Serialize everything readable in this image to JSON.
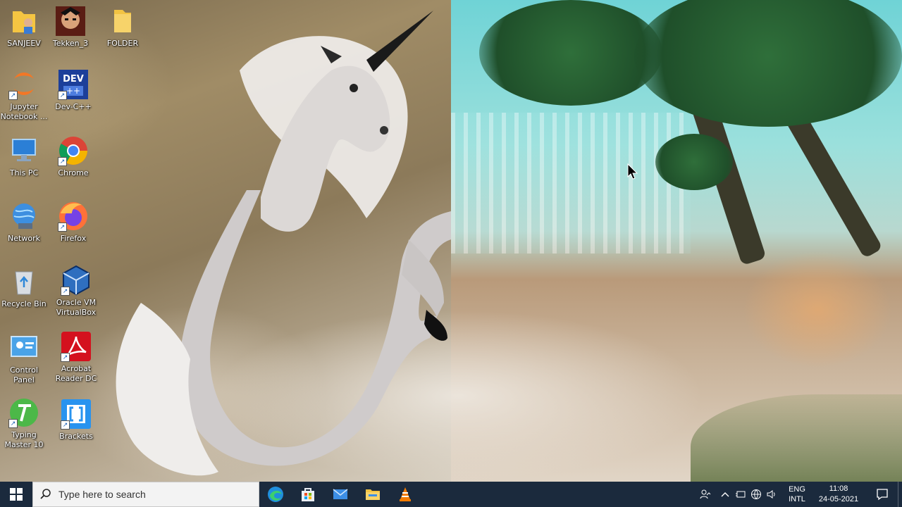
{
  "desktop": {
    "icons": [
      {
        "label": "SANJEEV",
        "icon": "user-folder-icon"
      },
      {
        "label": "Tekken_3",
        "icon": "tekken-game-icon"
      },
      {
        "label": "FOLDER",
        "icon": "folder-icon"
      },
      {
        "label": "Jupyter Notebook ...",
        "icon": "jupyter-icon"
      },
      {
        "label": "Dev-C++",
        "icon": "devcpp-icon"
      },
      {
        "label": "This PC",
        "icon": "this-pc-icon"
      },
      {
        "label": "Chrome",
        "icon": "chrome-icon"
      },
      {
        "label": "Network",
        "icon": "network-icon"
      },
      {
        "label": "Firefox",
        "icon": "firefox-icon"
      },
      {
        "label": "Recycle Bin",
        "icon": "recycle-bin-icon"
      },
      {
        "label": "Oracle VM VirtualBox",
        "icon": "virtualbox-icon"
      },
      {
        "label": "Control Panel",
        "icon": "control-panel-icon"
      },
      {
        "label": "Acrobat Reader DC",
        "icon": "acrobat-icon"
      },
      {
        "label": "Typing Master 10",
        "icon": "typing-master-icon"
      },
      {
        "label": "Brackets",
        "icon": "brackets-icon"
      }
    ],
    "devcpp_badge": "DEV"
  },
  "taskbar": {
    "search_placeholder": "Type here to search",
    "pinned": [
      "edge-icon",
      "store-icon",
      "mail-icon",
      "file-explorer-icon",
      "vlc-icon"
    ],
    "language_line1": "ENG",
    "language_line2": "INTL",
    "time": "11:08",
    "date": "24-05-2021",
    "accent": "#1b2a3d"
  }
}
